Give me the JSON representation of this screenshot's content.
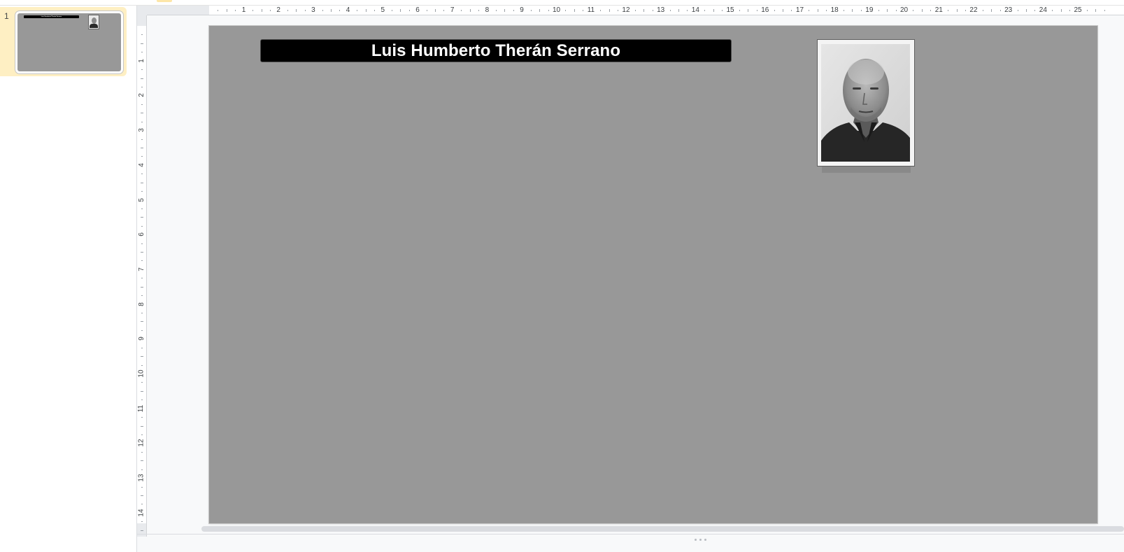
{
  "filmstrip": {
    "slides": [
      {
        "number": "1",
        "title": "Luis Humberto Therán Serrano"
      }
    ]
  },
  "ruler": {
    "horizontal_labels": [
      "1",
      "2",
      "3",
      "4",
      "5",
      "6",
      "7",
      "8",
      "9",
      "10",
      "11",
      "12",
      "13",
      "14",
      "15",
      "16",
      "17",
      "18",
      "19",
      "20",
      "21",
      "22",
      "23",
      "24",
      "25"
    ],
    "vertical_labels": [
      "1",
      "2",
      "3",
      "4",
      "5",
      "6",
      "7",
      "8",
      "9",
      "10",
      "11",
      "12",
      "13",
      "14"
    ]
  },
  "slide": {
    "background_color": "#989898",
    "title": "Luis Humberto Therán Serrano",
    "photo_description_icon": "portrait-photo"
  },
  "colors": {
    "selection_highlight": "#feefc3",
    "title_bar": "#000000",
    "title_text": "#ffffff"
  }
}
